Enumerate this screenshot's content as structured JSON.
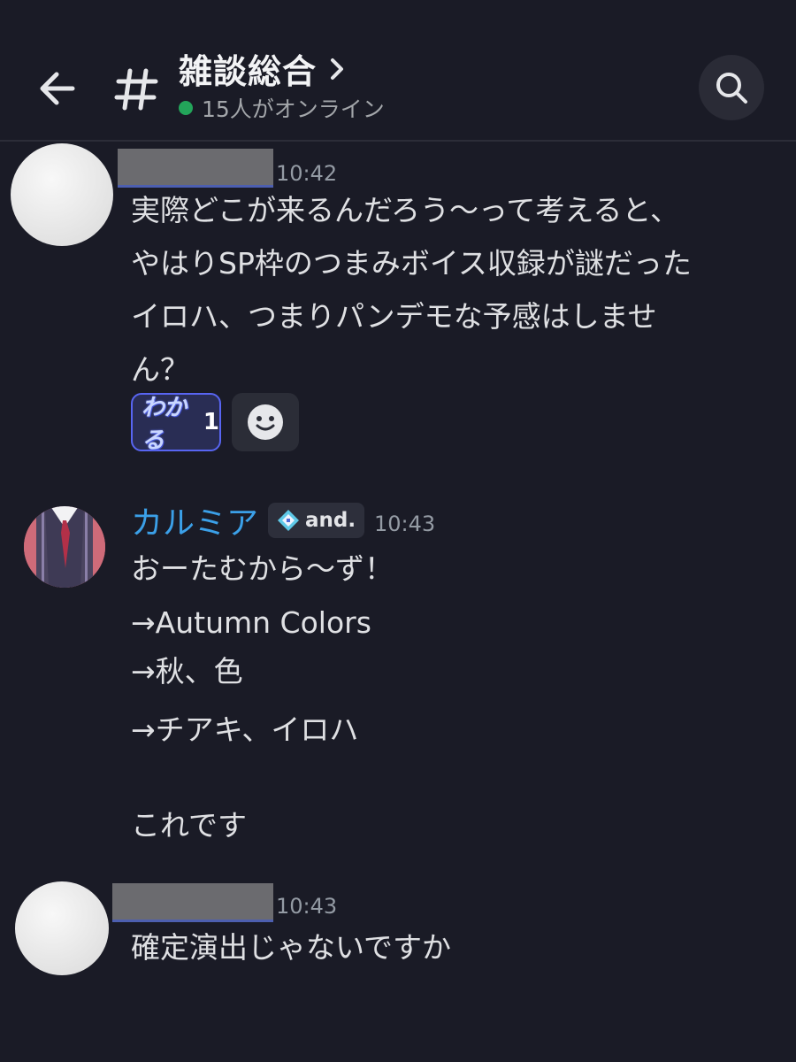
{
  "header": {
    "channel_name": "雑談総合",
    "online_status": "15人がオンライン"
  },
  "messages": [
    {
      "author": "",
      "time": "10:42",
      "text": "実際どこが来るんだろう〜って考えると、\nやはりSP枠のつまみボイス収録が謎だった\nイロハ、つまりパンデモな予感はしませ\nん？",
      "reactions": [
        {
          "emoji_text": "わかる",
          "count": "1"
        }
      ]
    },
    {
      "author": "カルミア",
      "tag": "and.",
      "time": "10:43",
      "lines": [
        "おーたむから〜ず！",
        "→Autumn Colors",
        "→秋、色",
        "→チアキ、イロハ",
        "これです"
      ]
    },
    {
      "author": "",
      "time": "10:43",
      "text": "確定演出じゃないですか"
    }
  ],
  "colors": {
    "background": "#1a1b26",
    "username_accent": "#3ba0e8",
    "online": "#23a55a",
    "reaction_active": "#5865f2"
  },
  "icons": {
    "back": "arrow-left-icon",
    "channel": "hash-icon",
    "header_chevron": "chevron-right-icon",
    "search": "search-icon",
    "add_reaction": "smiley-icon",
    "tag": "diamond-sparkle-icon"
  }
}
